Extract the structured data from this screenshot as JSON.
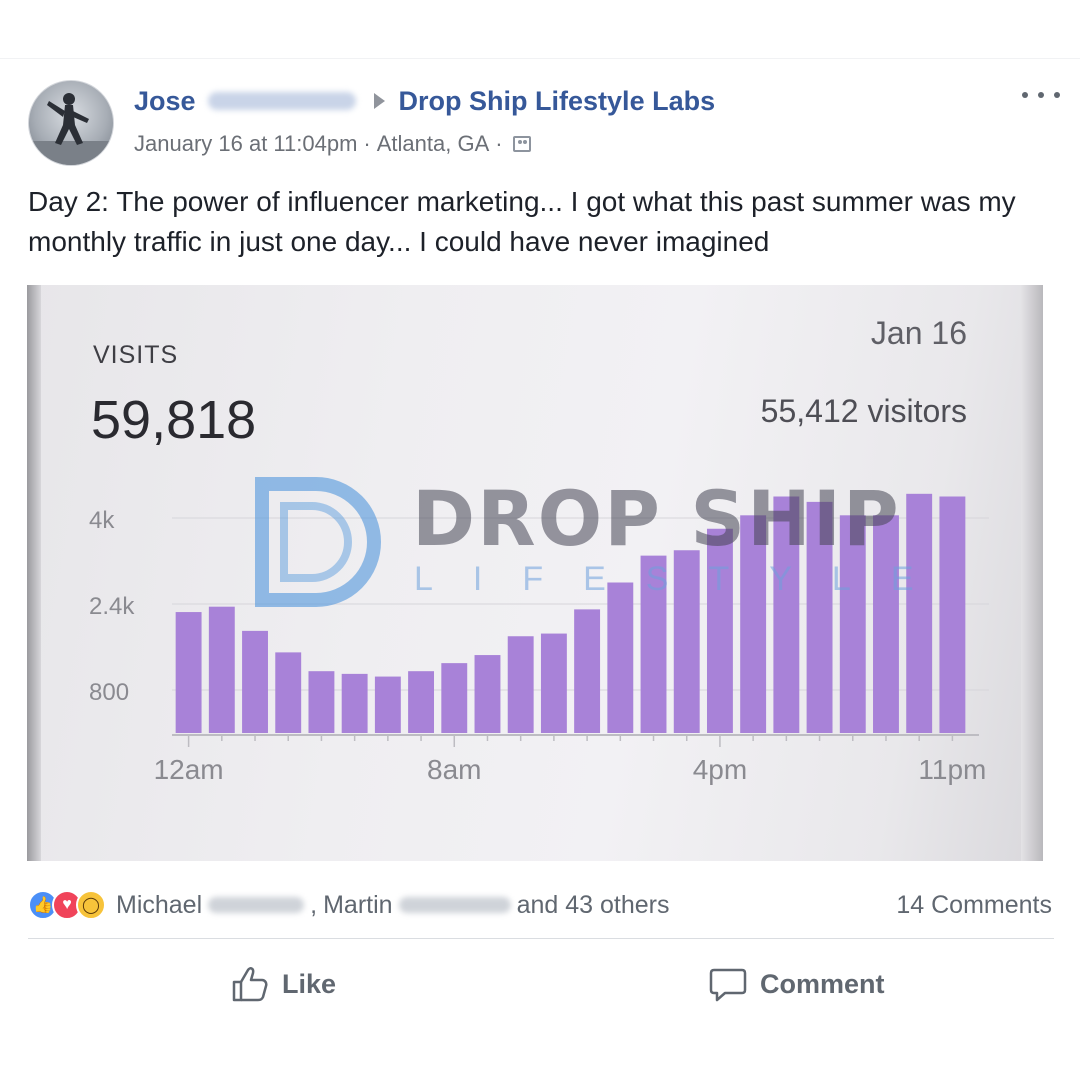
{
  "post": {
    "author_first": "Jose",
    "group": "Drop Ship Lifestyle Labs",
    "timestamp": "January 16 at 11:04pm",
    "location": "Atlanta, GA",
    "separator": "·",
    "text": "Day 2: The power of influencer marketing... I got what this past summer was my monthly traffic in just one day... I could have never imagined"
  },
  "photo": {
    "visits_label": "VISITS",
    "visits_value": "59,818",
    "date": "Jan 16",
    "visitors": "55,412 visitors",
    "watermark_title": "DROP SHIP",
    "watermark_sub": "LIFESTYLE"
  },
  "chart_data": {
    "type": "bar",
    "series": [
      {
        "values": [
          2250,
          2350,
          1900,
          1500,
          1150,
          1100,
          1050,
          1150,
          1300,
          1450,
          1800,
          1850,
          2300,
          2800,
          3300,
          3400,
          3800,
          4050,
          4400,
          4300,
          4050,
          4050,
          4450,
          4400
        ]
      }
    ],
    "x_tick_labels": [
      "12am",
      "8am",
      "4pm",
      "11pm"
    ],
    "y_tick_labels": [
      "4k",
      "2.4k",
      "800"
    ],
    "ylim": [
      0,
      4800
    ],
    "grid": true,
    "bar_color": "#a882d8"
  },
  "reactions": {
    "name1": "Michael",
    "sep": ",",
    "name2": "Martin",
    "others": "and 43 others",
    "comments": "14 Comments"
  },
  "actions": {
    "like": "Like",
    "comment": "Comment"
  },
  "colors": {
    "link": "#365899",
    "secondary": "#606770"
  }
}
